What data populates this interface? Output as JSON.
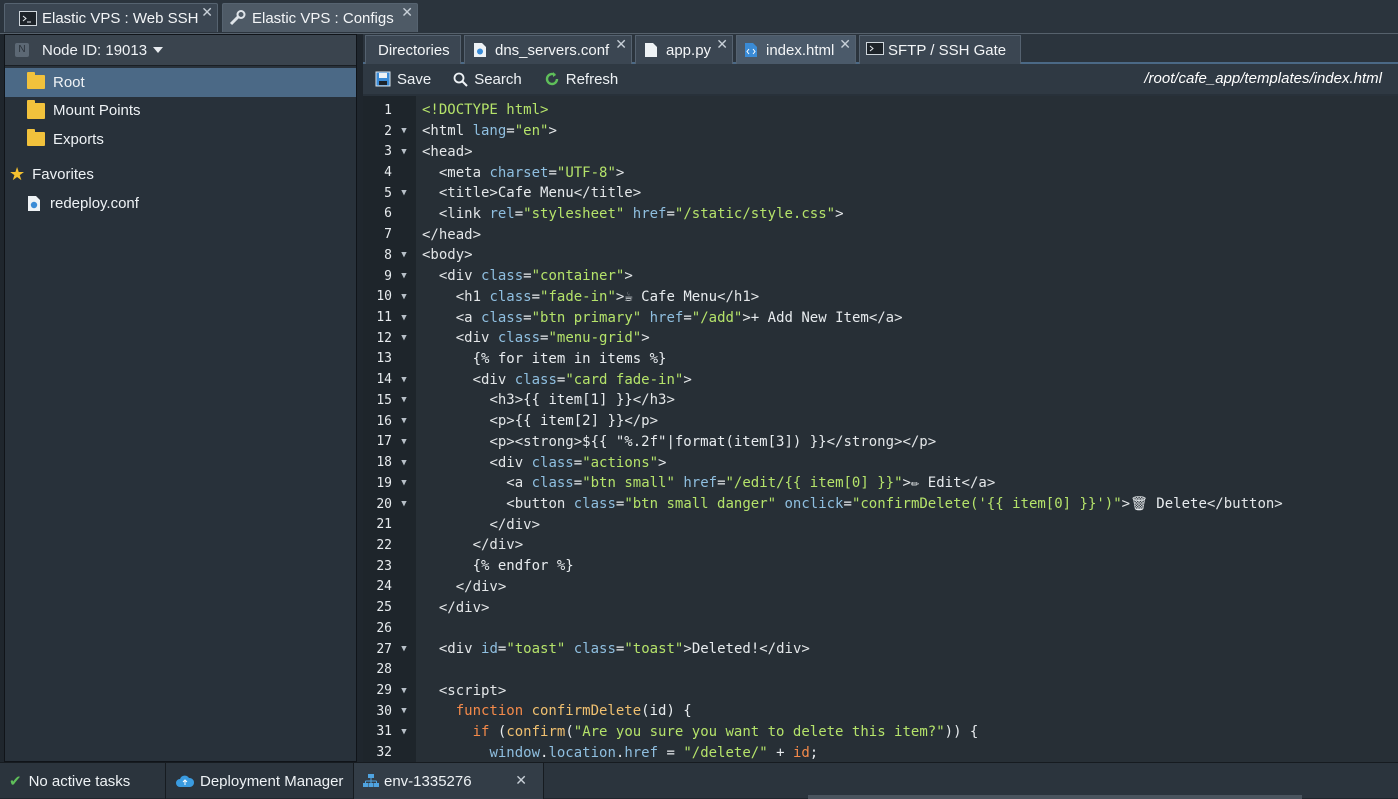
{
  "top_tabs": [
    {
      "label": "Elastic VPS : Web SSH",
      "icon": "terminal-icon",
      "active": false
    },
    {
      "label": "Elastic VPS : Configs",
      "icon": "wrench-icon",
      "active": true
    }
  ],
  "node": {
    "label": "Node ID: 19013"
  },
  "tree": {
    "items": [
      {
        "label": "Root",
        "icon": "folder-icon",
        "selected": true
      },
      {
        "label": "Mount Points",
        "icon": "mount-folder-icon"
      },
      {
        "label": "Exports",
        "icon": "export-folder-icon"
      }
    ],
    "favorites_label": "Favorites",
    "favorites": [
      {
        "label": "redeploy.conf",
        "icon": "config-file-icon"
      }
    ]
  },
  "file_tabs": [
    {
      "label": "Directories"
    },
    {
      "label": "dns_servers.conf"
    },
    {
      "label": "app.py"
    },
    {
      "label": "index.html",
      "active": true
    },
    {
      "label": "SFTP / SSH Gate"
    }
  ],
  "toolbar": {
    "save": "Save",
    "search": "Search",
    "refresh": "Refresh",
    "path": "/root/cafe_app/templates/index.html"
  },
  "code_lines": [
    "1",
    "2",
    "3",
    "4",
    "5",
    "6",
    "7",
    "8",
    "9",
    "10",
    "11",
    "12",
    "13",
    "14",
    "15",
    "16",
    "17",
    "18",
    "19",
    "20",
    "21",
    "22",
    "23",
    "24",
    "25",
    "26",
    "27",
    "28",
    "29",
    "30",
    "31",
    "32"
  ],
  "status": {
    "tasks": "No active tasks",
    "deployment": "Deployment Manager",
    "env": "env-1335276"
  }
}
